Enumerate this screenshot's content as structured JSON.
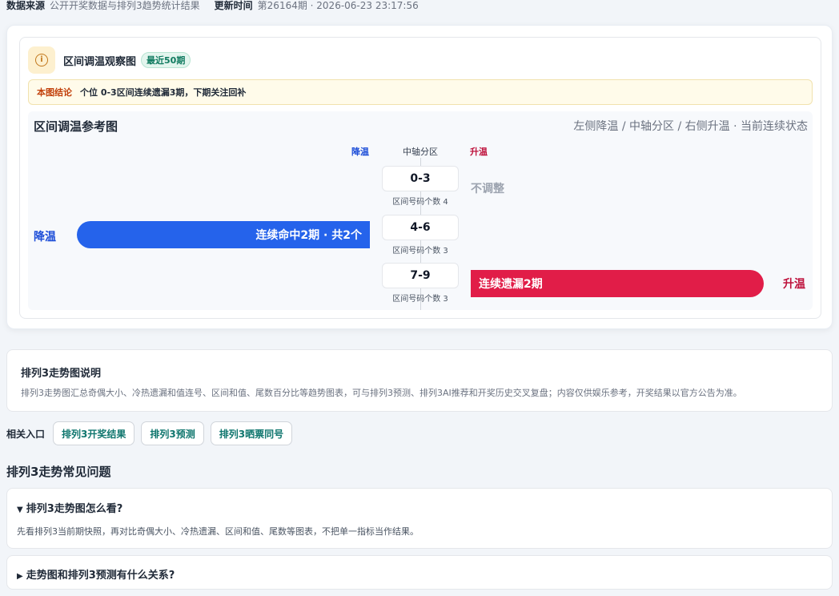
{
  "meta": {
    "source_label": "数据来源",
    "source_value": "公开开奖数据与排列3趋势统计结果",
    "updated_label": "更新时间",
    "updated_value": "第26164期 · 2026-06-23 23:17:56"
  },
  "observation": {
    "icon": "info-icon",
    "title": "区间调温观察图",
    "badge": "最近50期",
    "conclusion_label": "本图结论",
    "conclusion_text": "个位 0-3区间连续遗漏3期，下期关注回补"
  },
  "reference": {
    "title": "区间调温参考图",
    "subtitle": "左侧降温 / 中轴分区 / 右侧升温 · 当前连续状态",
    "axis_cool": "降温",
    "axis_mid": "中轴分区",
    "axis_warm": "升温",
    "side_cool": "降温",
    "side_warm": "升温",
    "zones": [
      {
        "name": "0-3",
        "count": "区间号码个数 4",
        "state": "不调整"
      },
      {
        "name": "4-6",
        "count": "区间号码个数 3",
        "state": "连续命中2期 · 共2个"
      },
      {
        "name": "7-9",
        "count": "区间号码个数 3",
        "state": "连续遗漏2期"
      }
    ],
    "colors": {
      "cool": "#2563eb",
      "warm": "#e11d48"
    }
  },
  "description": {
    "title": "排列3走势图说明",
    "text": "排列3走势图汇总奇偶大小、冷热遗漏和值连号、区间和值、尾数百分比等趋势图表，可与排列3预测、排列3AI推荐和开奖历史交叉复盘；内容仅供娱乐参考，开奖结果以官方公告为准。"
  },
  "related": {
    "label": "相关入口",
    "links": [
      "排列3开奖结果",
      "排列3预测",
      "排列3晒票同号"
    ]
  },
  "faq": {
    "title": "排列3走势常见问题",
    "items": [
      {
        "marker": "▼",
        "question": "排列3走势图怎么看?",
        "answer": "先看排列3当前期快照，再对比奇偶大小、冷热遗漏、区间和值、尾数等图表，不把单一指标当作结果。"
      },
      {
        "marker": "▶",
        "question": "走势图和排列3预测有什么关系?"
      }
    ]
  }
}
